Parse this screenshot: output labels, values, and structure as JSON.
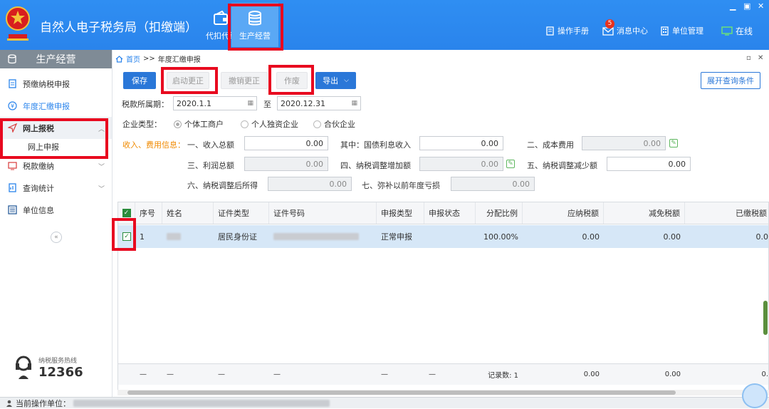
{
  "app": {
    "title": "自然人电子税务局（扣缴端）",
    "logo_icon": "tax-emblem-icon",
    "modules": [
      {
        "label": "代扣代缴",
        "icon": "wallet-icon"
      },
      {
        "label": "生产经营",
        "icon": "coins-icon"
      }
    ],
    "toolbar": {
      "manual": "操作手册",
      "messages": "消息中心",
      "messages_badge": "5",
      "unit_mgmt": "单位管理",
      "online": "在线"
    },
    "window_controls": [
      "▁",
      "▣",
      "✕"
    ]
  },
  "sidebar": {
    "header": "生产经营",
    "items": [
      {
        "label": "预缴纳税申报",
        "icon": "clipboard-icon"
      },
      {
        "label": "年度汇缴申报",
        "icon": "yen-circle-icon"
      },
      {
        "label": "网上报税",
        "icon": "send-icon"
      },
      {
        "label": "税款缴纳",
        "icon": "payment-icon"
      },
      {
        "label": "查询统计",
        "icon": "report-icon"
      },
      {
        "label": "单位信息",
        "icon": "list-icon"
      }
    ],
    "sub_item": "网上申报",
    "collapse": "«",
    "hotline_label": "纳税服务热线",
    "hotline_number": "12366"
  },
  "breadcrumb": {
    "home": "首页",
    "sep": ">>",
    "current": "年度汇缴申报"
  },
  "buttons": {
    "save": "保存",
    "start_correction": "启动更正",
    "cancel_correction": "撤销更正",
    "void": "作废",
    "export": "导出",
    "expand_query": "展开查询条件"
  },
  "form": {
    "period_label": "税款所属期：",
    "period_from": "2020.1.1",
    "period_to_label": "至",
    "period_to": "2020.12.31",
    "enterprise_type_label": "企业类型：",
    "enterprise_types": [
      "个体工商户",
      "个人独资企业",
      "合伙企业"
    ],
    "income_info_label": "收入、费用信息：",
    "fields": {
      "total_income": {
        "label": "一、收入总额",
        "value": "0.00"
      },
      "bond_interest": {
        "label": "其中：国债利息收入",
        "value": "0.00"
      },
      "costs": {
        "label": "二、成本费用",
        "value": "0.00"
      },
      "total_profit": {
        "label": "三、利润总额",
        "value": "0.00"
      },
      "tax_increase": {
        "label": "四、纳税调整增加额",
        "value": "0.00"
      },
      "tax_decrease": {
        "label": "五、纳税调整减少额",
        "value": "0.00"
      },
      "adjusted_income": {
        "label": "六、纳税调整后所得",
        "value": "0.00"
      },
      "prior_loss": {
        "label": "七、弥补以前年度亏损",
        "value": "0.00"
      }
    }
  },
  "table": {
    "columns": [
      "序号",
      "姓名",
      "证件类型",
      "证件号码",
      "申报类型",
      "申报状态",
      "分配比例",
      "应纳税额",
      "减免税额",
      "已缴税额"
    ],
    "rows": [
      {
        "index": "1",
        "name": "",
        "id_type": "居民身份证",
        "id_number": "",
        "declare_type": "正常申报",
        "declare_status": "",
        "ratio": "100.00%",
        "tax_payable": "0.00",
        "tax_relief": "0.00",
        "tax_paid": "0.0"
      }
    ],
    "footer": {
      "dash": "—",
      "record_count": "记录数: 1",
      "tax_payable": "0.00",
      "tax_relief": "0.00",
      "tax_paid": "0."
    }
  },
  "status_bar": {
    "label": "当前操作单位："
  },
  "colors": {
    "topbar": "#2a84ec",
    "primary": "#2a77d8",
    "highlight": "#e8091f",
    "orange_label": "#f08a00",
    "row_selected": "#d6e7f7"
  }
}
